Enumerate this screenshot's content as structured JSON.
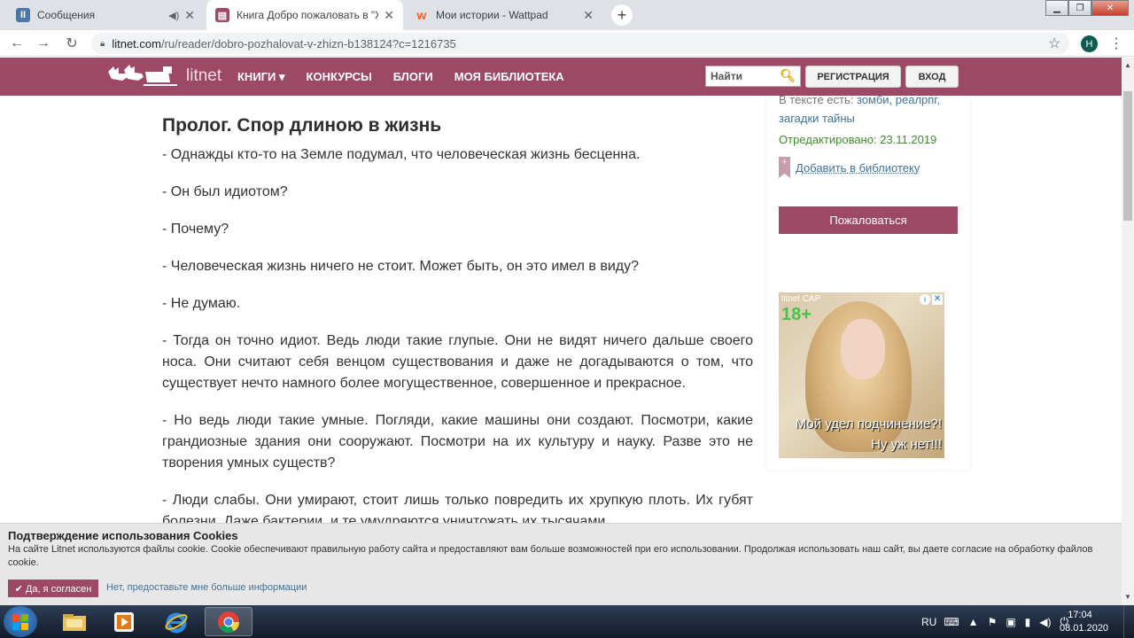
{
  "browser": {
    "tabs": [
      {
        "title": "Сообщения",
        "icon": "messages-icon",
        "icon_color": "#4a76a8",
        "active": false
      },
      {
        "title": "Книга Добро пожаловать в \"Ж",
        "icon": "litnet-icon",
        "icon_color": "#9d4864",
        "active": true
      },
      {
        "title": "Мои истории - Wattpad",
        "icon": "wattpad-icon",
        "icon_color": "#ff6122",
        "active": false
      }
    ],
    "url_domain": "litnet.com",
    "url_path": "/ru/reader/dobro-pozhalovat-v-zhizn-b138124?c=1216735",
    "profile_initial": "H"
  },
  "site": {
    "brand_color": "#9d4864",
    "logo_text": "litnet",
    "nav": [
      "КНИГИ ▾",
      "КОНКУРСЫ",
      "БЛОГИ",
      "МОЯ БИБЛИОТЕКА"
    ],
    "search_placeholder": "Найти",
    "register_label": "РЕГИСТРАЦИЯ",
    "login_label": "ВХОД"
  },
  "chapter": {
    "title": "Пролог. Спор длиною в жизнь",
    "paragraphs": [
      "- Однажды кто-то на Земле подумал, что человеческая жизнь бесценна.",
      "- Он был идиотом?",
      "- Почему?",
      "- Человеческая жизнь ничего не стоит. Может быть, он это имел в виду?",
      "- Не думаю.",
      "- Тогда он точно идиот. Ведь люди такие глупые. Они не видят ничего дальше своего носа. Они считают себя венцом существования и даже не догадываются о том, что существует нечто намного более могущественное, совершенное и прекрасное.",
      "- Но ведь люди такие умные. Погляди, какие машины они создают. Посмотри, какие грандиозные здания они сооружают. Посмотри на их культуру и науку. Разве это не творения умных существ?",
      "- Люди слабы. Они умирают, стоит лишь только повредить их хрупкую плоть. Их губят болезни. Даже бактерии, и те умудряются уничтожать их тысячами"
    ]
  },
  "sidebar": {
    "tags_prefix": "В тексте есть: ",
    "tags_part1": "зомби, реалрпг,",
    "tags_part2": "загадки тайны",
    "edited": "Отредактировано: 23.11.2019",
    "add_library": "Добавить в библиотеку",
    "report": "Пожаловаться",
    "ad": {
      "logo": "litnet САР",
      "age": "18+",
      "line1": "Мой удел подчинение?!",
      "line2": "Ну уж нет!!!"
    }
  },
  "cookie": {
    "title": "Подтверждение использования Cookies",
    "text": "На сайте Litnet используются файлы cookie. Cookie обеспечивают правильную работу сайта и предоставляют вам больше возможностей при его использовании. Продолжая использовать наш сайт, вы даете согласие на обработку файлов cookie.",
    "agree": "✔ Да, я согласен",
    "more": "Нет, предоставьте мне больше информации"
  },
  "taskbar": {
    "lang": "RU",
    "time": "17:04",
    "date": "08.01.2020",
    "apps": [
      "explorer-icon",
      "media-player-icon",
      "ie-icon",
      "chrome-icon"
    ]
  }
}
